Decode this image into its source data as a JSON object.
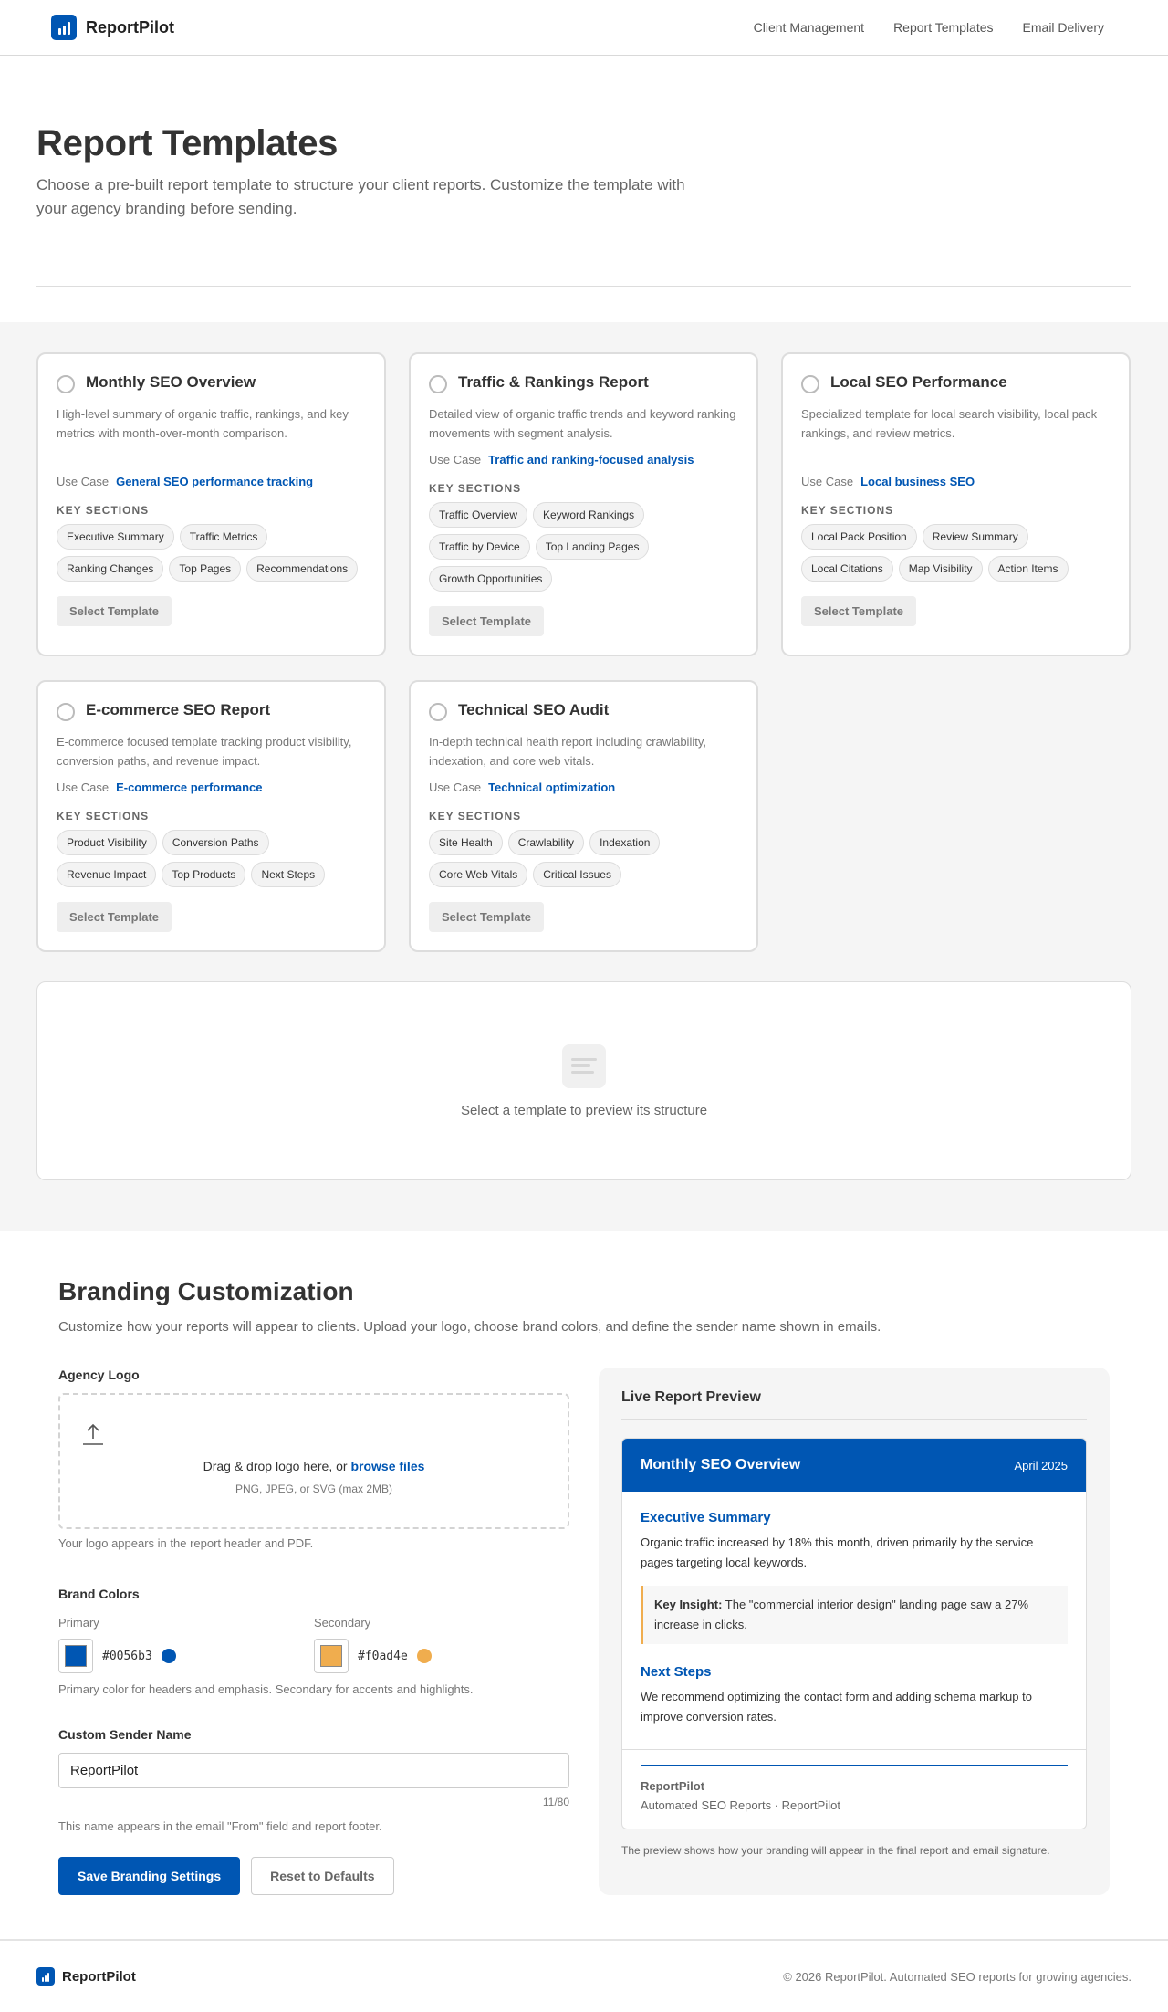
{
  "header": {
    "brand": "ReportPilot",
    "nav": [
      "Client Management",
      "Report Templates",
      "Email Delivery"
    ]
  },
  "hero": {
    "title": "Report Templates",
    "subtitle": "Choose a pre-built report template to structure your client reports. Customize the template with your agency branding before sending."
  },
  "templates": {
    "use_case_label": "Use Case",
    "key_sections_label": "KEY SECTIONS",
    "select_label": "Select Template",
    "items": [
      {
        "title": "Monthly SEO Overview",
        "description": "High-level summary of organic traffic, rankings, and key metrics with month-over-month comparison.",
        "use_case": "General SEO performance tracking",
        "sections": [
          "Executive Summary",
          "Traffic Metrics",
          "Ranking Changes",
          "Top Pages",
          "Recommendations"
        ]
      },
      {
        "title": "Traffic & Rankings Report",
        "description": "Detailed view of organic traffic trends and keyword ranking movements with segment analysis.",
        "use_case": "Traffic and ranking-focused analysis",
        "sections": [
          "Traffic Overview",
          "Keyword Rankings",
          "Traffic by Device",
          "Top Landing Pages",
          "Growth Opportunities"
        ]
      },
      {
        "title": "Local SEO Performance",
        "description": "Specialized template for local search visibility, local pack rankings, and review metrics.",
        "use_case": "Local business SEO",
        "sections": [
          "Local Pack Position",
          "Review Summary",
          "Local Citations",
          "Map Visibility",
          "Action Items"
        ]
      },
      {
        "title": "E-commerce SEO Report",
        "description": "E-commerce focused template tracking product visibility, conversion paths, and revenue impact.",
        "use_case": "E-commerce performance",
        "sections": [
          "Product Visibility",
          "Conversion Paths",
          "Revenue Impact",
          "Top Products",
          "Next Steps"
        ]
      },
      {
        "title": "Technical SEO Audit",
        "description": "In-depth technical health report including crawlability, indexation, and core web vitals.",
        "use_case": "Technical optimization",
        "sections": [
          "Site Health",
          "Crawlability",
          "Indexation",
          "Core Web Vitals",
          "Critical Issues"
        ]
      }
    ],
    "empty_preview": "Select a template to preview its structure"
  },
  "branding": {
    "title": "Branding Customization",
    "subtitle": "Customize how your reports will appear to clients. Upload your logo, choose brand colors, and define the sender name shown in emails.",
    "logo": {
      "label": "Agency Logo",
      "drop_text": "Drag & drop logo here, or ",
      "browse": "browse files",
      "formats": "PNG, JPEG, or SVG (max 2MB)",
      "hint": "Your logo appears in the report header and PDF."
    },
    "colors": {
      "label": "Brand Colors",
      "primary_label": "Primary",
      "primary_hex": "#0056b3",
      "secondary_label": "Secondary",
      "secondary_hex": "#f0ad4e",
      "hint": "Primary color for headers and emphasis. Secondary for accents and highlights."
    },
    "sender": {
      "label": "Custom Sender Name",
      "value": "ReportPilot",
      "counter": "11/80",
      "hint": "This name appears in the email \"From\" field and report footer."
    },
    "save_label": "Save Branding Settings",
    "reset_label": "Reset to Defaults",
    "preview": {
      "title": "Live Report Preview",
      "report_title": "Monthly SEO Overview",
      "report_date": "April 2025",
      "h1": "Executive Summary",
      "p1": "Organic traffic increased by 18% this month, driven primarily by the service pages targeting local keywords.",
      "insight_label": "Key Insight:",
      "insight_text": " The \"commercial interior design\" landing page saw a 27% increase in clicks.",
      "h2": "Next Steps",
      "p2": "We recommend optimizing the contact form and adding schema markup to improve conversion rates.",
      "footer_name": "ReportPilot",
      "footer_sub": "Automated SEO Reports · ReportPilot",
      "note": "The preview shows how your branding will appear in the final report and email signature."
    }
  },
  "footer": {
    "brand": "ReportPilot",
    "copyright": "© 2026 ReportPilot. Automated SEO reports for growing agencies."
  }
}
